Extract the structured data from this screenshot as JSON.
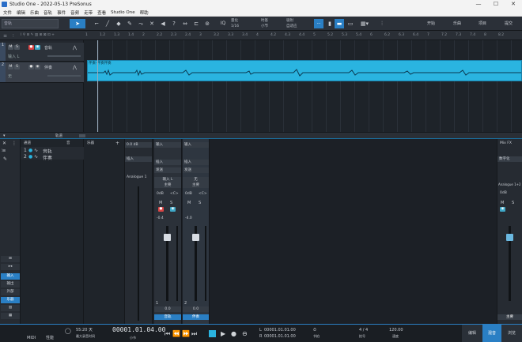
{
  "window": {
    "title": "Studio One - 2022-05-13 PreSonus",
    "controls": [
      "—",
      "☐",
      "✕"
    ]
  },
  "menu": [
    "文件",
    "编辑",
    "乐曲",
    "音轨",
    "事件",
    "音频",
    "走带",
    "查看",
    "Studio One",
    "帮助"
  ],
  "toolbar": {
    "dropdown": "音轨",
    "iq": "IQ",
    "snap_label": "量化",
    "snap_value": "1/16",
    "timebase_label": "时基",
    "timebase_value": "小节",
    "snap2_label": "吸附",
    "snap2_value": "自适应",
    "btn_start": "开始",
    "btn_song": "乐曲",
    "btn_project": "项目",
    "btn_share": "提交"
  },
  "ruler": [
    "1",
    "1.2",
    "1.3",
    "1.4",
    "2",
    "2.2",
    "2.3",
    "2.4",
    "3",
    "3.2",
    "3.3",
    "3.4",
    "4",
    "4.2",
    "4.3",
    "4.4",
    "5",
    "5.2",
    "5.3",
    "5.4",
    "6",
    "6.2",
    "6.3",
    "6.4",
    "7",
    "7.2",
    "7.3",
    "7.4",
    "8",
    "8.2"
  ],
  "tracks": [
    {
      "num": "1",
      "name": "音轨",
      "input": "输入 L"
    },
    {
      "num": "2",
      "name": "伴奏",
      "input": "无"
    }
  ],
  "clip": {
    "label": "伴奏-伴奏伴奏"
  },
  "arrange_bottom": {
    "label": "轨道"
  },
  "mix_list": {
    "col1": "通道",
    "col2": "音",
    "col3": "乐器",
    "rows": [
      {
        "num": "1",
        "name": "音轨"
      },
      {
        "num": "2",
        "name": "伴奏"
      }
    ]
  },
  "side_buttons": [
    "输入",
    "输出",
    "外部",
    "乐器",
    "",
    "",
    "",
    ""
  ],
  "inputs_strip": {
    "label": "输入",
    "sub": "插入",
    "val": "0.0 dB"
  },
  "analog": {
    "label": "Analogue 1"
  },
  "strips": [
    {
      "top": "输入",
      "insert": "插入",
      "send": "发送",
      "input": "输入 L",
      "main": "主要",
      "db": "0dB",
      "pan": "<C>",
      "m": "M",
      "s": "S",
      "val": "-0.4",
      "bottom_val": "0.0",
      "name": "音轨"
    },
    {
      "top": "输入",
      "insert": "插入",
      "send": "发送",
      "input": "无",
      "main": "主要",
      "db": "0dB",
      "pan": "<C>",
      "m": "M",
      "s": "S",
      "val": "-4.0",
      "bottom_val": "0.0",
      "name": "伴奏"
    }
  ],
  "right_pane": {
    "label": "Mix FX",
    "sub": "数字化",
    "out": "Analogue 1+2",
    "db": "0dB",
    "m": "M",
    "s": "S",
    "name": "主要"
  },
  "transport": {
    "midi": "MIDI",
    "perf": "性能",
    "time1": "55:20 天",
    "time1_sub": "最大录音时间",
    "pos_main": "00001.01.04.00",
    "pos_sub": "小节",
    "loop_l": "00001.01.01.00",
    "loop_r": "00001.01.01.00",
    "l_label": "L",
    "r_label": "R",
    "metronome": "节拍",
    "sig": "4 / 4",
    "sig_label": "拍号",
    "tempo": "120.00",
    "tempo_label": "速度",
    "btn_edit": "编辑",
    "btn_mix": "混音",
    "btn_browse": "浏览"
  },
  "colors": {
    "accent": "#2a7fc4",
    "clip": "#2ab4e0",
    "record": "#d94545"
  }
}
